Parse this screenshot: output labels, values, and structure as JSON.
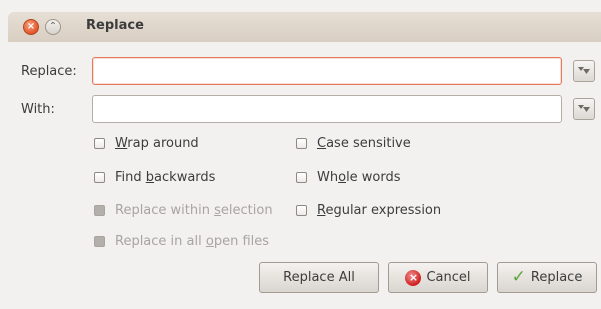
{
  "window": {
    "title": "Replace",
    "close_glyph": "×",
    "minimize_glyph": "⌃"
  },
  "replace": {
    "label": "Replace:",
    "value": ""
  },
  "with": {
    "label": "With:",
    "value": ""
  },
  "options": {
    "wrap_around": {
      "pre": "",
      "key": "W",
      "post": "rap around",
      "checked": false
    },
    "case_sensitive": {
      "pre": "",
      "key": "C",
      "post": "ase sensitive",
      "checked": false
    },
    "find_backwards": {
      "pre": "Find ",
      "key": "b",
      "post": "ackwards",
      "checked": false
    },
    "whole_words": {
      "pre": "Wh",
      "key": "o",
      "post": "le words",
      "checked": false
    },
    "replace_within_selection": {
      "pre": "Replace within ",
      "key": "s",
      "post": "election",
      "disabled": true
    },
    "regular_expression": {
      "pre": "",
      "key": "R",
      "post": "egular expression",
      "checked": false
    },
    "replace_all_open_files": {
      "pre": "Replace in all ",
      "key": "o",
      "post": "pen files",
      "disabled": true
    }
  },
  "buttons": {
    "replace_all": "Replace All",
    "cancel": "Cancel",
    "replace": "Replace"
  },
  "icons": {
    "close": "close-icon",
    "minimize": "minimize-icon",
    "history": "history-dropdown-icon",
    "cancel": "cancel-icon",
    "confirm": "checkmark-icon"
  },
  "colors": {
    "focus_border": "#e57a5a",
    "titlebar": "#dcd3c8",
    "close_button": "#e2562b"
  }
}
